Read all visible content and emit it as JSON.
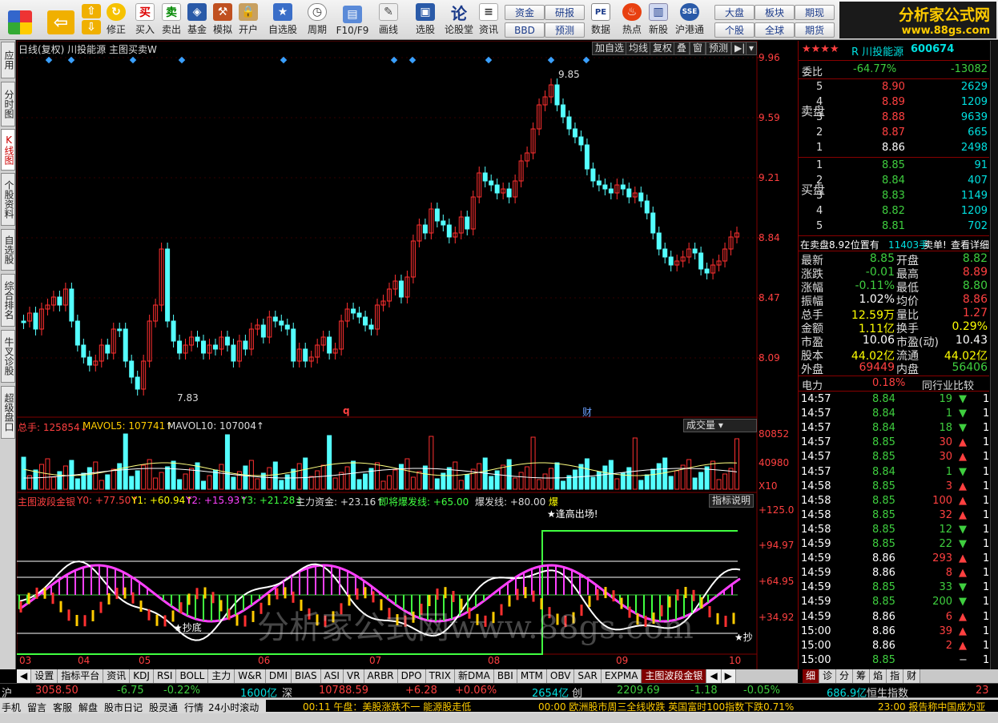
{
  "toolbar": {
    "buttons": [
      "",
      "",
      "修正",
      "买入",
      "卖出",
      "基金",
      "模拟",
      "开户",
      "自选股",
      "周期",
      "F10/F9",
      "画线",
      "选股",
      "论股堂",
      "资讯",
      "",
      "",
      "数据",
      "热点",
      "新股",
      "沪港通"
    ],
    "small": [
      "资金",
      "BBD",
      "研报",
      "预测",
      "大盘",
      "个股",
      "板块",
      "全球",
      "期现",
      "期货"
    ],
    "logo_title": "分析家公式网",
    "logo_url": "www.88gs.com"
  },
  "left_tabs": [
    "应用",
    "分时图",
    "K线图",
    "个股资料",
    "自选股",
    "综合排名",
    "牛叉诊股",
    "超级盘口"
  ],
  "chart": {
    "header_title": "日线(复权)  川投能源  主图买卖W",
    "header_buttons": [
      "加自选",
      "均线",
      "复权",
      "叠",
      "窗",
      "预测"
    ],
    "price_ticks": [
      "9.96",
      "9.59",
      "9.21",
      "8.84",
      "8.47",
      "8.09"
    ],
    "high_label": "9.85",
    "low_label": "7.83",
    "marker_q": "q",
    "marker_cai": "财",
    "volume_legend": {
      "total": "总手: 125854↓",
      "mavol5": "MAVOL5: 107741↑",
      "mavol10": "MAVOL10: 107004↑"
    },
    "volume_button": "成交量",
    "volume_ticks": [
      "80852",
      "40980",
      "X10"
    ],
    "indicator_legend": {
      "name": "主图波段金银",
      "y0": "Y0: +77.50↑",
      "y1": "Y1: +60.94↑",
      "y2": "Y2: +15.93↑",
      "y3": "Y3: +21.28↓",
      "main_fund": "主力资金: +23.16↑",
      "near": "即将爆发线: +65.00",
      "burst": "爆发线: +80.00",
      "tail": "爆"
    },
    "indicator_button": "指标说明",
    "indicator_ticks": [
      "+125.0",
      "+94.97",
      "+64.95",
      "+34.92"
    ],
    "indicator_notes": [
      "★逢高出场!",
      "★抄底",
      "★抄"
    ],
    "months": [
      "03",
      "04",
      "05",
      "06",
      "07",
      "08",
      "09",
      "10"
    ],
    "watermark": "分析家公式网www.88gs.com"
  },
  "quote": {
    "stars": "★★★★",
    "name": "R 川投能源",
    "code": "600674",
    "weibi_label": "委比",
    "weibi_pct": "-64.77%",
    "weibi_diff": "-13082",
    "sell_label": "卖盘",
    "buy_label": "买盘",
    "sells": [
      {
        "n": "5",
        "p": "8.90",
        "v": "2629"
      },
      {
        "n": "4",
        "p": "8.89",
        "v": "1209"
      },
      {
        "n": "3",
        "p": "8.88",
        "v": "9639"
      },
      {
        "n": "2",
        "p": "8.87",
        "v": "665"
      },
      {
        "n": "1",
        "p": "8.86",
        "v": "2498"
      }
    ],
    "buys": [
      {
        "n": "1",
        "p": "8.85",
        "v": "91"
      },
      {
        "n": "2",
        "p": "8.84",
        "v": "407"
      },
      {
        "n": "3",
        "p": "8.83",
        "v": "1149"
      },
      {
        "n": "4",
        "p": "8.82",
        "v": "1209"
      },
      {
        "n": "5",
        "p": "8.81",
        "v": "702"
      }
    ],
    "info_line": {
      "a": "在卖盘8.92位置有",
      "b": "11403手",
      "c": "卖单!",
      "d": "查看详细"
    },
    "stats": [
      {
        "l1": "最新",
        "v1": "8.85",
        "c1": "g",
        "l2": "开盘",
        "v2": "8.82",
        "c2": "g"
      },
      {
        "l1": "涨跌",
        "v1": "-0.01",
        "c1": "g",
        "l2": "最高",
        "v2": "8.89",
        "c2": "r"
      },
      {
        "l1": "涨幅",
        "v1": "-0.11%",
        "c1": "g",
        "l2": "最低",
        "v2": "8.80",
        "c2": "g"
      },
      {
        "l1": "振幅",
        "v1": "1.02%",
        "c1": "w",
        "l2": "均价",
        "v2": "8.86",
        "c2": "r"
      },
      {
        "l1": "总手",
        "v1": "12.59万",
        "c1": "y",
        "l2": "量比",
        "v2": "1.27",
        "c2": "r"
      },
      {
        "l1": "金额",
        "v1": "1.11亿",
        "c1": "y",
        "l2": "换手",
        "v2": "0.29%",
        "c2": "y"
      },
      {
        "l1": "市盈",
        "v1": "10.06",
        "c1": "w",
        "l2": "市盈(动)",
        "v2": "10.43",
        "c2": "w"
      },
      {
        "l1": "股本",
        "v1": "44.02亿",
        "c1": "y",
        "l2": "流通",
        "v2": "44.02亿",
        "c2": "y"
      },
      {
        "l1": "外盘",
        "v1": "69449",
        "c1": "r",
        "l2": "内盘",
        "v2": "56406",
        "c2": "g"
      }
    ],
    "industry": {
      "name": "电力",
      "pct": "0.18%",
      "compare": "同行业比较"
    },
    "ticks": [
      {
        "t": "14:57",
        "p": "8.84",
        "v": "19",
        "d": "down"
      },
      {
        "t": "14:57",
        "p": "8.84",
        "v": "1",
        "d": "down"
      },
      {
        "t": "14:57",
        "p": "8.84",
        "v": "18",
        "d": "down"
      },
      {
        "t": "14:57",
        "p": "8.85",
        "v": "30",
        "d": "up"
      },
      {
        "t": "14:57",
        "p": "8.85",
        "v": "30",
        "d": "up"
      },
      {
        "t": "14:57",
        "p": "8.84",
        "v": "1",
        "d": "down"
      },
      {
        "t": "14:58",
        "p": "8.85",
        "v": "3",
        "d": "up"
      },
      {
        "t": "14:58",
        "p": "8.85",
        "v": "100",
        "d": "up"
      },
      {
        "t": "14:58",
        "p": "8.85",
        "v": "32",
        "d": "up"
      },
      {
        "t": "14:58",
        "p": "8.85",
        "v": "12",
        "d": "down"
      },
      {
        "t": "14:59",
        "p": "8.85",
        "v": "22",
        "d": "down"
      },
      {
        "t": "14:59",
        "p": "8.86",
        "v": "293",
        "d": "up"
      },
      {
        "t": "14:59",
        "p": "8.86",
        "v": "8",
        "d": "up"
      },
      {
        "t": "14:59",
        "p": "8.85",
        "v": "33",
        "d": "down"
      },
      {
        "t": "14:59",
        "p": "8.85",
        "v": "200",
        "d": "down"
      },
      {
        "t": "14:59",
        "p": "8.86",
        "v": "6",
        "d": "up"
      },
      {
        "t": "15:00",
        "p": "8.86",
        "v": "39",
        "d": "up"
      },
      {
        "t": "15:00",
        "p": "8.86",
        "v": "2",
        "d": "up"
      },
      {
        "t": "15:00",
        "p": "8.85",
        "v": "",
        "d": "none"
      }
    ],
    "tick_tail": "1"
  },
  "bottom_tabs": [
    "设置",
    "指标平台",
    "资讯",
    "KDJ",
    "RSI",
    "BOLL",
    "主力",
    "W&R",
    "DMI",
    "BIAS",
    "ASI",
    "VR",
    "ARBR",
    "DPO",
    "TRIX",
    "新DMA",
    "BBI",
    "MTM",
    "OBV",
    "SAR",
    "EXPMA",
    "主图波段金银"
  ],
  "right_tabs": [
    "细",
    "诊",
    "分",
    "筹",
    "焰",
    "指",
    "财"
  ],
  "status": {
    "sh_label": "沪",
    "sh_val": "3058.50",
    "sh_chg": "-6.75",
    "sh_pct": "-0.22%",
    "sh_amt": "1600亿",
    "sz_label": "深",
    "sz_val": "10788.59",
    "sz_chg": "+6.28",
    "sz_pct": "+0.06%",
    "sz_amt": "2654亿",
    "cy_label": "创",
    "cy_val": "2209.69",
    "cy_chg": "-1.18",
    "cy_pct": "-0.05%",
    "cy_amt": "686.9亿",
    "hs_label": "恒生指数",
    "hs_tail": "23"
  },
  "ticker": {
    "links": [
      "手机",
      "留言",
      "客服",
      "解盘",
      "股市日记",
      "股灵通",
      "行情",
      "24小时滚动"
    ],
    "news1": "00:11 午盘：美股涨跌不一 能源股走低",
    "news2": "00:00 欧洲股市周三全线收跌 英国富时100指数下跌0.71%",
    "news3": "23:00 报告称中国成为亚"
  },
  "colors": {
    "up": "#ff3030",
    "down": "#54ffff",
    "grid": "#800000",
    "accent": "#ffcc00"
  }
}
